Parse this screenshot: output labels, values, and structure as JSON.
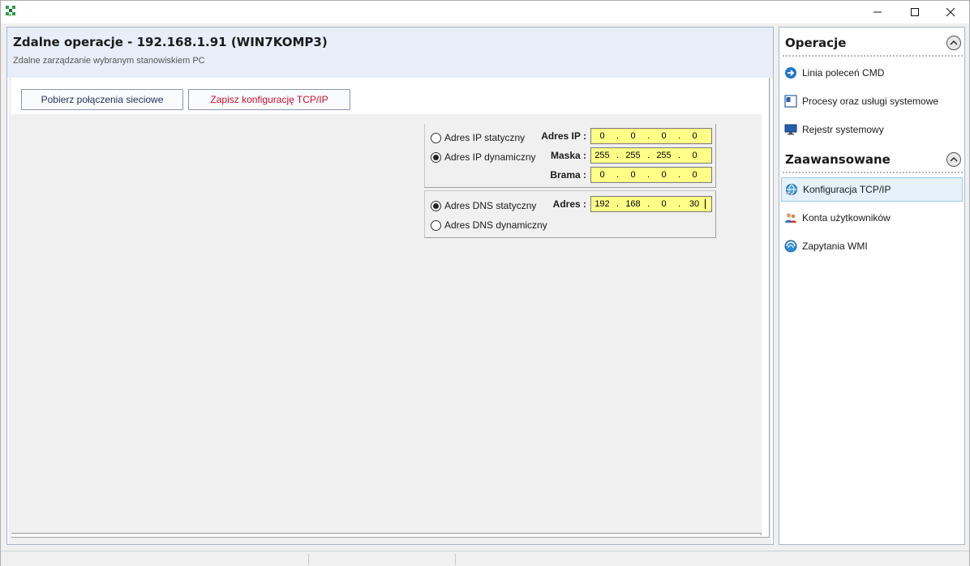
{
  "window": {
    "controls": {
      "minimize_icon": "minimize-icon",
      "maximize_icon": "maximize-icon",
      "close_icon": "close-icon"
    }
  },
  "main": {
    "title": "Zdalne operacje - 192.168.1.91 (WIN7KOMP3)",
    "subtitle": "Zdalne zarządzanie wybranym stanowiskiem PC",
    "buttons": {
      "fetch_label": "Pobierz połączenia sieciowe",
      "save_label": "Zapisz konfigurację TCP/IP"
    },
    "tcpip": {
      "ip_mode": {
        "static_label": "Adres IP statyczny",
        "dynamic_label": "Adres IP dynamiczny",
        "selected": "dynamic"
      },
      "ip_fields": {
        "ip_label": "Adres IP :",
        "ip_octets": [
          "0",
          "0",
          "0",
          "0"
        ],
        "mask_label": "Maska :",
        "mask_octets": [
          "255",
          "255",
          "255",
          "0"
        ],
        "gateway_label": "Brama :",
        "gateway_octets": [
          "0",
          "0",
          "0",
          "0"
        ]
      },
      "dns_mode": {
        "static_label": "Adres DNS statyczny",
        "dynamic_label": "Adres DNS dynamiczny",
        "selected": "static"
      },
      "dns_fields": {
        "address_label": "Adres :",
        "address_octets": [
          "192",
          "168",
          "0",
          "30"
        ]
      },
      "field_color": "#ffff88"
    }
  },
  "side": {
    "operations": {
      "title": "Operacje",
      "items": [
        {
          "label": "Linia poleceń CMD",
          "icon": "arrow-right-circle-icon"
        },
        {
          "label": "Procesy oraz usługi systemowe",
          "icon": "process-window-icon"
        },
        {
          "label": "Rejestr systemowy",
          "icon": "monitor-icon"
        }
      ]
    },
    "advanced": {
      "title": "Zaawansowane",
      "items": [
        {
          "label": "Konfiguracja TCP/IP",
          "icon": "network-globe-icon",
          "selected": true
        },
        {
          "label": "Konta użytkowników",
          "icon": "users-icon"
        },
        {
          "label": "Zapytania WMI",
          "icon": "wmi-globe-icon"
        }
      ]
    }
  },
  "colors": {
    "accent": "#c8102e",
    "header_bg": "#e8eef8",
    "selection": "#e5f1fb"
  }
}
